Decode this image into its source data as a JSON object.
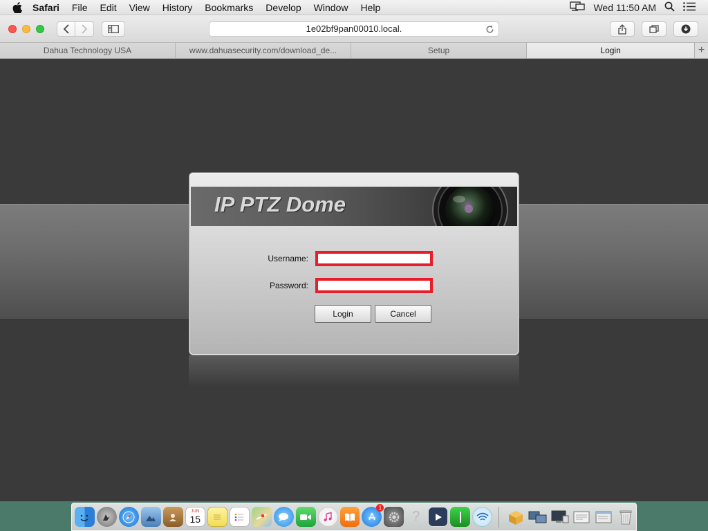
{
  "menubar": {
    "app_name": "Safari",
    "items": [
      "File",
      "Edit",
      "View",
      "History",
      "Bookmarks",
      "Develop",
      "Window",
      "Help"
    ],
    "clock": "Wed 11:50 AM"
  },
  "toolbar": {
    "address": "1e02bf9pan00010.local."
  },
  "tabs": [
    {
      "label": "Dahua Technology USA"
    },
    {
      "label": "www.dahuasecurity.com/download_de..."
    },
    {
      "label": "Setup"
    },
    {
      "label": "Login"
    }
  ],
  "tab_add_label": "+",
  "login": {
    "banner_title": "IP PTZ Dome",
    "username_label": "Username:",
    "password_label": "Password:",
    "username_value": "",
    "password_value": "",
    "login_button": "Login",
    "cancel_button": "Cancel"
  },
  "dock": {
    "calendar_month": "JUN",
    "calendar_day": "15",
    "appstore_badge": "1",
    "help_glyph": "?"
  },
  "colors": {
    "field_border": "#e81d2a",
    "background": "#3a3a3a",
    "band": "#6a6a6a"
  }
}
